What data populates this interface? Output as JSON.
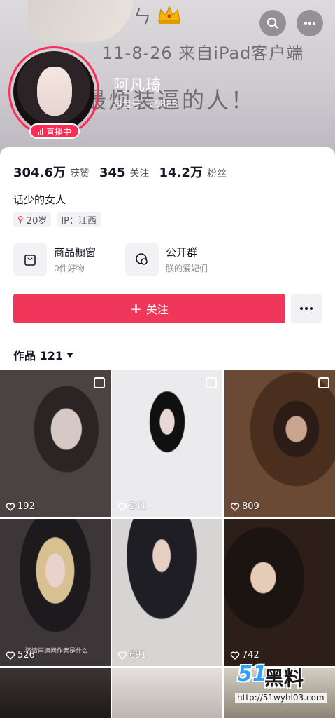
{
  "cover": {
    "line1": "ㄣ",
    "line2": "11-8-26 来自iPad客户端",
    "line3": "最烦装逼的人！"
  },
  "profile": {
    "nickname": "阿凡琦",
    "uid": "抖音号：c9888",
    "live_badge": "直播中",
    "stats": [
      {
        "num": "304.6万",
        "label": "获赞"
      },
      {
        "num": "345",
        "label": "关注"
      },
      {
        "num": "14.2万",
        "label": "粉丝"
      }
    ],
    "bio": "话少的女人",
    "tags": {
      "age": "20岁",
      "ip": "IP：江西"
    },
    "features": [
      {
        "title": "商品橱窗",
        "sub": "0件好物",
        "icon": "shop-bag-icon"
      },
      {
        "title": "公开群",
        "sub": "朕的爱妃们",
        "icon": "chat-group-icon"
      }
    ],
    "follow_label": "关注",
    "works_label": "作品 121"
  },
  "grid": {
    "items": [
      {
        "likes": "192",
        "multi": true
      },
      {
        "likes": "241",
        "multi": true
      },
      {
        "likes": "809",
        "multi": true
      },
      {
        "likes": "526",
        "multi": false,
        "caption": "还请再追问作者是什么"
      },
      {
        "likes": "691",
        "multi": false
      },
      {
        "likes": "742",
        "multi": false
      },
      {
        "likes": "",
        "multi": false
      },
      {
        "likes": "",
        "multi": false
      },
      {
        "likes": "",
        "multi": false
      }
    ]
  },
  "watermark": {
    "num": "51",
    "word": "黑料",
    "url": "http://51wyhl03.com"
  },
  "colors": {
    "accent": "#fe2c55",
    "follow": "#f0365a"
  }
}
